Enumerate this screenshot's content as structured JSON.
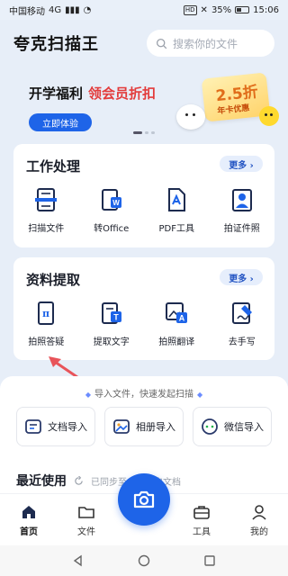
{
  "status_bar": {
    "carrier": "中国移动",
    "network": "4G",
    "battery_percent": "35%",
    "battery_level": 0.35,
    "time": "15:06"
  },
  "header": {
    "app_title": "夸克扫描王",
    "search_placeholder": "搜索你的文件"
  },
  "banner": {
    "headline": "开学福利",
    "highlight": "领会员折扣",
    "cta_label": "立即体验",
    "ticket_value": "2.5折",
    "ticket_caption": "年卡优惠"
  },
  "work_section": {
    "title": "工作处理",
    "more_label": "更多 ›",
    "tools": [
      {
        "label": "扫描文件",
        "icon": "scan-document-icon"
      },
      {
        "label": "转Office",
        "icon": "convert-office-icon"
      },
      {
        "label": "PDF工具",
        "icon": "pdf-tool-icon"
      },
      {
        "label": "拍证件照",
        "icon": "id-photo-icon"
      }
    ]
  },
  "extract_section": {
    "title": "资料提取",
    "more_label": "更多 ›",
    "tools": [
      {
        "label": "拍照答疑",
        "icon": "photo-question-icon"
      },
      {
        "label": "提取文字",
        "icon": "extract-text-icon"
      },
      {
        "label": "拍照翻译",
        "icon": "photo-translate-icon"
      },
      {
        "label": "去手写",
        "icon": "remove-handwriting-icon"
      }
    ]
  },
  "import_panel": {
    "hint": "导入文件，快速发起扫描",
    "buttons": [
      {
        "label": "文档导入",
        "icon": "document-import-icon"
      },
      {
        "label": "相册导入",
        "icon": "album-import-icon"
      },
      {
        "label": "微信导入",
        "icon": "wechat-import-icon"
      }
    ]
  },
  "recent": {
    "title": "最近使用",
    "subtitle": "已同步至…下历史文档"
  },
  "bottom_nav": {
    "items": [
      {
        "label": "首页",
        "icon": "home-icon"
      },
      {
        "label": "文件",
        "icon": "folder-icon"
      },
      {
        "label": "工具",
        "icon": "toolbox-icon"
      },
      {
        "label": "我的",
        "icon": "profile-icon"
      }
    ]
  },
  "colors": {
    "accent": "#1e64e8",
    "background": "#e7eef8",
    "annotation": "#e8545a"
  }
}
